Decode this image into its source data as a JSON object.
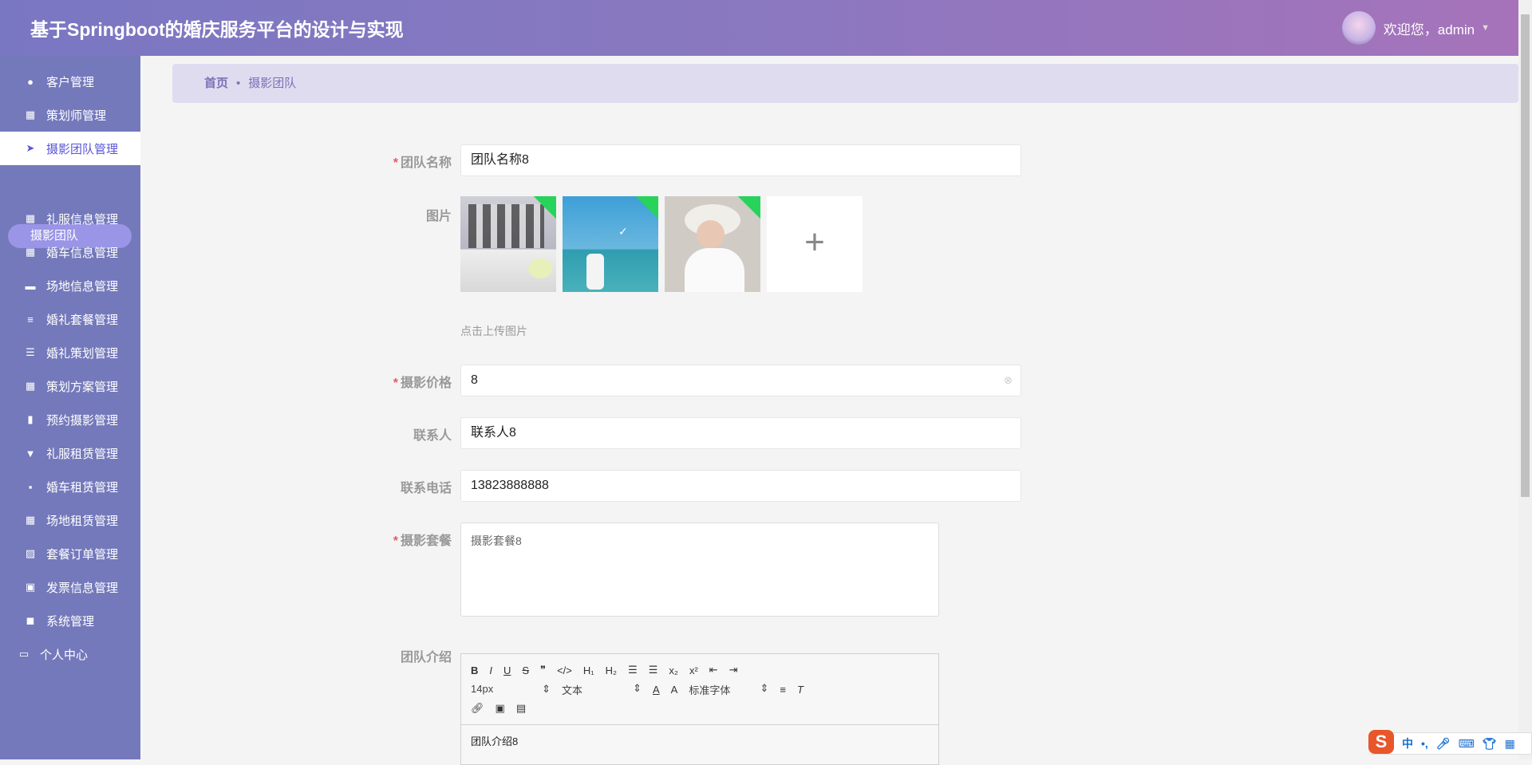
{
  "header": {
    "title": "基于Springboot的婚庆服务平台的设计与实现",
    "welcome": "欢迎您，admin"
  },
  "sidebar": {
    "items": [
      {
        "label": "客户管理",
        "icon": "bulb-icon"
      },
      {
        "label": "策划师管理",
        "icon": "grid-icon"
      },
      {
        "label": "摄影团队管理",
        "icon": "send-icon"
      },
      {
        "label": "礼服信息管理",
        "icon": "grid-icon"
      },
      {
        "label": "婚车信息管理",
        "icon": "grid-icon"
      },
      {
        "label": "场地信息管理",
        "icon": "ticket-icon"
      },
      {
        "label": "婚礼套餐管理",
        "icon": "sliders-icon"
      },
      {
        "label": "婚礼策划管理",
        "icon": "list-icon"
      },
      {
        "label": "策划方案管理",
        "icon": "grid-icon"
      },
      {
        "label": "预约摄影管理",
        "icon": "book-icon"
      },
      {
        "label": "礼服租赁管理",
        "icon": "brush-icon"
      },
      {
        "label": "婚车租赁管理",
        "icon": "chat-icon"
      },
      {
        "label": "场地租赁管理",
        "icon": "grid-icon"
      },
      {
        "label": "套餐订单管理",
        "icon": "chart-icon"
      },
      {
        "label": "发票信息管理",
        "icon": "clipboard-icon"
      },
      {
        "label": "系统管理",
        "icon": "camera-icon"
      },
      {
        "label": "个人中心",
        "icon": "card-icon"
      }
    ],
    "sub_item": "摄影团队"
  },
  "breadcrumb": {
    "home": "首页",
    "current": "摄影团队"
  },
  "form": {
    "team_name": {
      "label": "团队名称",
      "value": "团队名称8"
    },
    "images": {
      "label": "图片",
      "hint": "点击上传图片",
      "count": 3
    },
    "price": {
      "label": "摄影价格",
      "value": "8"
    },
    "contact": {
      "label": "联系人",
      "value": "联系人8"
    },
    "phone": {
      "label": "联系电话",
      "value": "13823888888"
    },
    "package": {
      "label": "摄影套餐",
      "value": "摄影套餐8"
    },
    "intro": {
      "label": "团队介绍",
      "value": "团队介绍8",
      "toolbar": {
        "size": "14px",
        "header": "文本",
        "font": "标准字体"
      }
    }
  },
  "ime": {
    "lang": "中"
  }
}
